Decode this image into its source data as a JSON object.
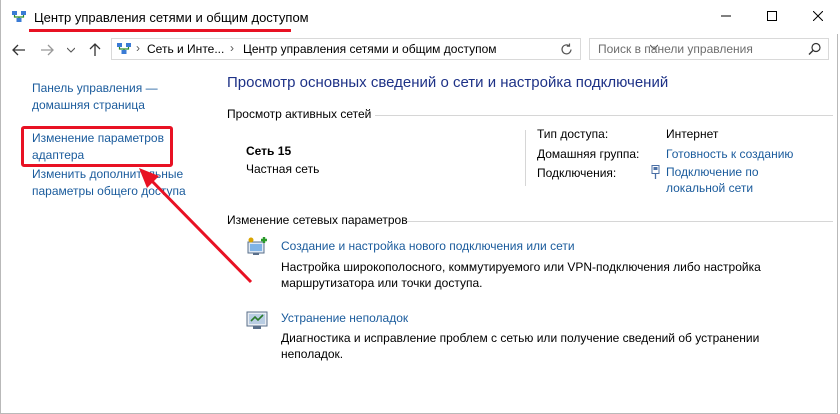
{
  "window": {
    "title": "Центр управления сетями и общим доступом",
    "accent_color": "#e81123"
  },
  "navbar": {
    "breadcrumb_1": "Сеть и Инте...",
    "breadcrumb_2": "Центр управления сетями и общим доступом",
    "search_placeholder": "Поиск в панели управления"
  },
  "sidebar": {
    "home_link": [
      "Панель управления —",
      "домашняя страница"
    ],
    "adapter_link": [
      "Изменение параметров",
      "адаптера"
    ],
    "sharing_link": [
      "Изменить дополнительные",
      "параметры общего доступа"
    ]
  },
  "main": {
    "heading": "Просмотр основных сведений о сети и настройка подключений",
    "active_networks_label": "Просмотр активных сетей",
    "network_name": "Сеть  15",
    "network_type": "Частная сеть",
    "access_type_label": "Тип доступа:",
    "access_type_value": "Интернет",
    "homegroup_label": "Домашняя группа:",
    "homegroup_value": "Готовность к созданию",
    "connections_label": "Подключения:",
    "connections_value": [
      "Подключение по",
      "локальной сети"
    ],
    "change_settings_label": "Изменение сетевых параметров",
    "new_connection_link": "Создание и настройка нового подключения или сети",
    "new_connection_desc": [
      "Настройка широкополосного, коммутируемого или VPN-подключения либо настройка",
      "маршрутизатора или точки доступа."
    ],
    "troubleshoot_link": "Устранение неполадок",
    "troubleshoot_desc": [
      "Диагностика и исправление проблем с сетью или получение сведений об устранении",
      "неполадок."
    ]
  }
}
